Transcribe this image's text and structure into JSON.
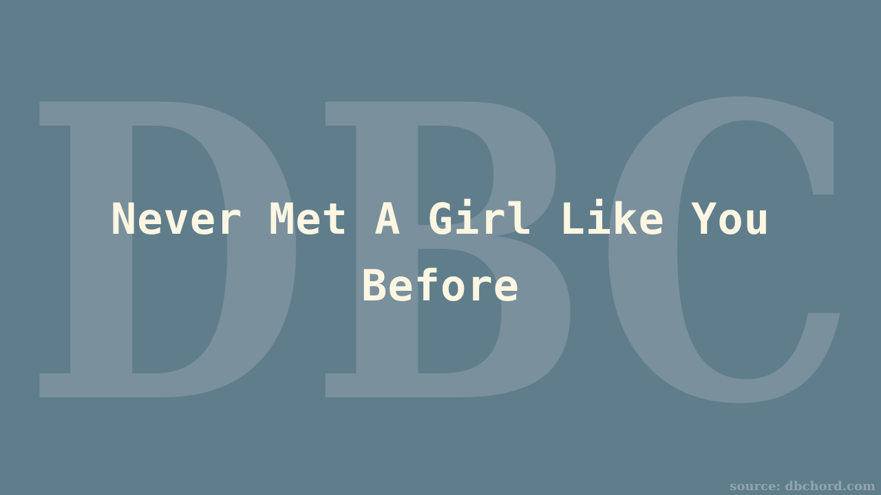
{
  "watermark": {
    "text": "DBC",
    "color": "#7a909c"
  },
  "title": "Never Met A Girl Like You Before",
  "source": "source: dbchord.com",
  "colors": {
    "background": "#607d8b",
    "title": "#fdf6e3",
    "source": "#8fa5b0"
  }
}
